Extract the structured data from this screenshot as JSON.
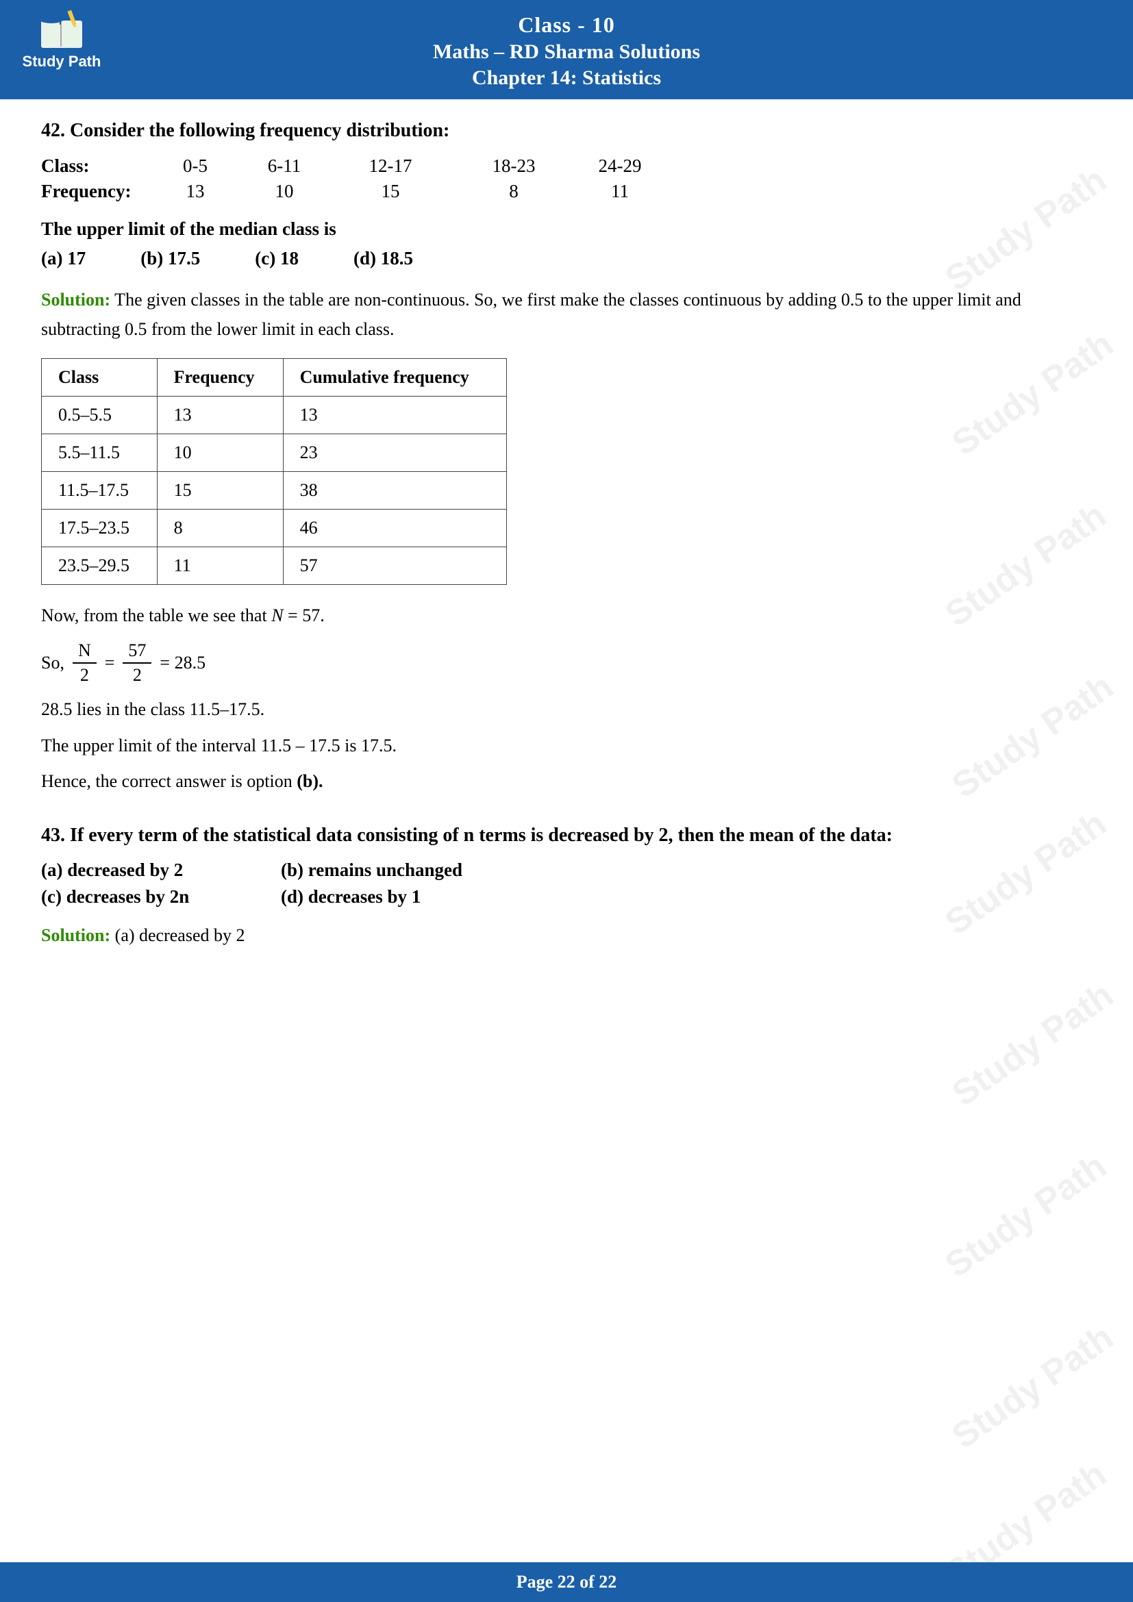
{
  "header": {
    "line1": "Class - 10",
    "line2": "Maths – RD Sharma Solutions",
    "line3": "Chapter 14: Statistics"
  },
  "logo": {
    "text": "Study Path"
  },
  "footer": {
    "text": "Page 22 of 22"
  },
  "watermark": "Study Path",
  "q42": {
    "title": "42. Consider the following frequency distribution:",
    "table_header": {
      "col1": "Class:",
      "col2": "0-5",
      "col3": "6-11",
      "col4": "12-17",
      "col5": "18-23",
      "col6": "24-29"
    },
    "table_freq": {
      "col1": "Frequency:",
      "col2": "13",
      "col3": "10",
      "col4": "15",
      "col5": "8",
      "col6": "11"
    },
    "question_text": "The upper limit of the median class is",
    "options": {
      "a": "(a) 17",
      "b": "(b) 17.5",
      "c": "(c) 18",
      "d": "(d) 18.5"
    },
    "solution_label": "Solution:",
    "solution_intro": " The given classes in the table are non-continuous. So, we first make the classes continuous by adding 0.5 to the upper limit and subtracting 0.5 from the lower limit in each class.",
    "data_table": {
      "headers": [
        "Class",
        "Frequency",
        "Cumulative frequency"
      ],
      "rows": [
        [
          "0.5–5.5",
          "13",
          "13"
        ],
        [
          "5.5–11.5",
          "10",
          "23"
        ],
        [
          "11.5–17.5",
          "15",
          "38"
        ],
        [
          "17.5–23.5",
          "8",
          "46"
        ],
        [
          "23.5–29.5",
          "11",
          "57"
        ]
      ]
    },
    "n_text": "Now, from the table we see that N = 57.",
    "fraction_text": "So,",
    "fraction_label": "N",
    "fraction_denom": "2",
    "fraction_num": "57",
    "fraction_num2": "2",
    "equals": "= 28.5",
    "class_text": "28.5 lies in the class 11.5–17.5.",
    "upper_text": "The upper limit of the interval 11.5 – 17.5 is 17.5.",
    "hence_text": "Hence, the correct answer is option",
    "answer_option": "(b).",
    "answer_option_bold": true
  },
  "q43": {
    "title": "43. If every term of the statistical data consisting of n terms is decreased by 2, then the mean of the data:",
    "options": {
      "a": "(a) decreased by 2",
      "b": "(b) remains unchanged",
      "c": "(c) decreases by 2n",
      "d": "(d) decreases by 1"
    },
    "solution_label": "Solution:",
    "solution_text": " (a) decreased by 2"
  }
}
